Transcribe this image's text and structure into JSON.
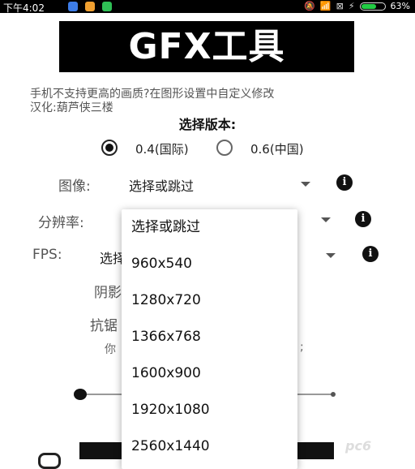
{
  "status_bar": {
    "time": "下午4:02",
    "battery_percent": 63,
    "battery_text": "63%",
    "accent_green": "#22cc44",
    "app_icons": [
      "mail-app-icon",
      "photo-app-icon",
      "chat-app-icon"
    ]
  },
  "header": {
    "title": "GFX工具"
  },
  "notice": {
    "line1": "手机不支持更高的画质?在图形设置中自定义修改",
    "line2": "汉化:葫芦侠三楼"
  },
  "version": {
    "title": "选择版本:",
    "options": [
      {
        "label": "0.4(国际)",
        "selected": true
      },
      {
        "label": "0.6(中国)",
        "selected": false
      }
    ]
  },
  "settings": [
    {
      "label": "图像:",
      "value": "选择或跳过"
    },
    {
      "label": "分辨率:",
      "value": ""
    },
    {
      "label": "FPS:",
      "value": "选择"
    },
    {
      "label": "阴影",
      "value": ""
    },
    {
      "label": "抗锯",
      "value": ""
    }
  ],
  "hint": {
    "left": "你",
    "right": ";"
  },
  "dropdown": {
    "items": [
      "选择或跳过",
      "960x540",
      "1280x720",
      "1366x768",
      "1600x900",
      "1920x1080",
      "2560x1440"
    ]
  },
  "watermark": "pc6"
}
